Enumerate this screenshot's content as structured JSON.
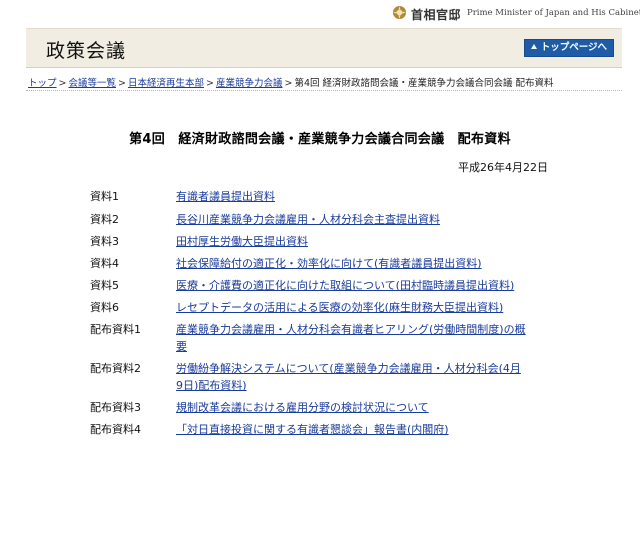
{
  "topbar": {
    "org_jp": "首相官邸",
    "org_en": "Prime Minister of Japan and His Cabinet"
  },
  "header": {
    "title": "政策会議",
    "top_button": "トップページへ"
  },
  "breadcrumb": [
    {
      "label": "トップ",
      "link": true
    },
    {
      "label": "会議等一覧",
      "link": true
    },
    {
      "label": "日本経済再生本部",
      "link": true
    },
    {
      "label": "産業競争力会議",
      "link": true
    },
    {
      "label": "第4回 経済財政諮問会議・産業競争力会議合同会議 配布資料",
      "link": false
    }
  ],
  "breadcrumb_sep": ">",
  "page_title": "第4回　経済財政諮問会議・産業競争力会議合同会議　配布資料",
  "date": "平成26年4月22日",
  "documents": [
    {
      "label": "資料1",
      "link_text": "有識者議員提出資料"
    },
    {
      "label": "資料2",
      "link_text": "長谷川産業競争力会議雇用・人材分科会主査提出資料"
    },
    {
      "label": "資料3",
      "link_text": "田村厚生労働大臣提出資料"
    },
    {
      "label": "資料4",
      "link_text": "社会保障給付の適正化・効率化に向けて(有識者議員提出資料)"
    },
    {
      "label": "資料5",
      "link_text": "医療・介護費の適正化に向けた取組について(田村臨時議員提出資料)"
    },
    {
      "label": "資料6",
      "link_text": "レセプトデータの活用による医療の効率化(麻生財務大臣提出資料)"
    },
    {
      "label": "配布資料1",
      "link_text": "産業競争力会議雇用・人材分科会有識者ヒアリング(労働時間制度)の概要"
    },
    {
      "label": "配布資料2",
      "link_text": "労働紛争解決システムについて(産業競争力会議雇用・人材分科会(4月9日)配布資料)"
    },
    {
      "label": "配布資料3",
      "link_text": "規制改革会議における雇用分野の検討状況について"
    },
    {
      "label": "配布資料4",
      "link_text": "「対日直接投資に関する有識者懇談会」報告書(内閣府)"
    }
  ]
}
